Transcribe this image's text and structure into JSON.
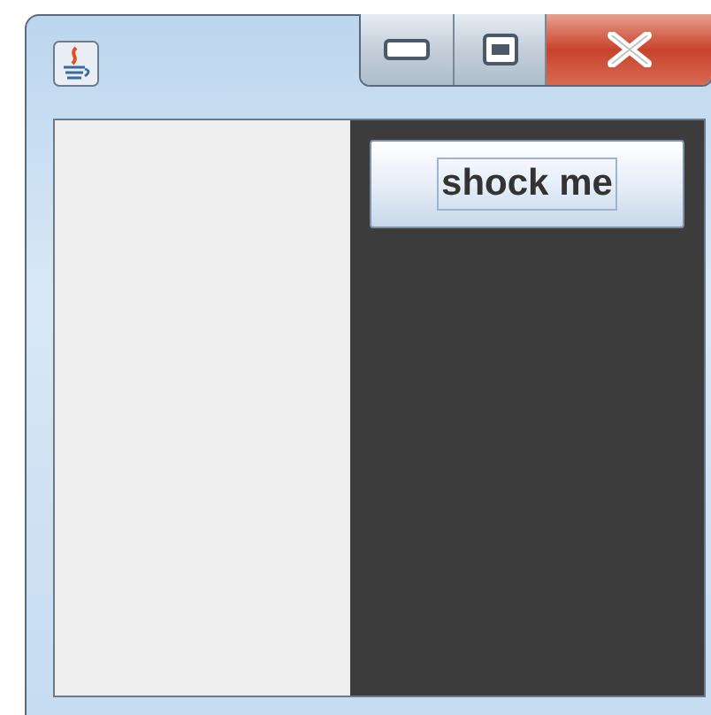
{
  "window": {
    "controls": [
      {
        "kind": "minimize"
      },
      {
        "kind": "maximize"
      },
      {
        "kind": "close"
      }
    ]
  },
  "button": {
    "label": "shock me",
    "focused": true
  }
}
